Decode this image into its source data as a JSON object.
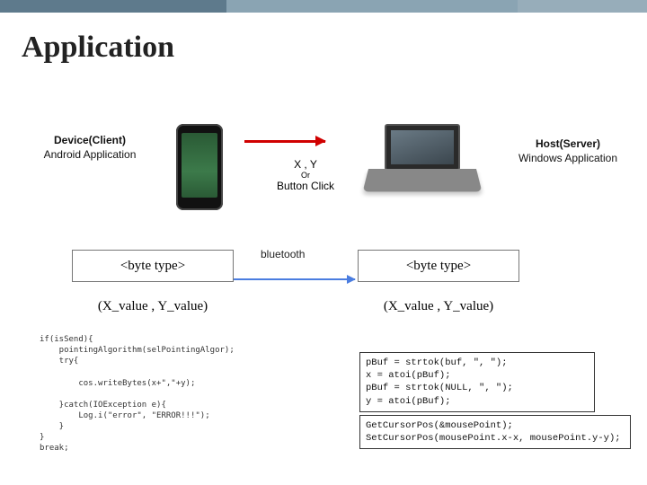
{
  "title": "Application",
  "client": {
    "heading": "Device(Client)",
    "sub": "Android Application"
  },
  "host": {
    "heading": "Host(Server)",
    "sub": "Windows Application"
  },
  "transfer": {
    "xy": "X , Y",
    "or": "Or",
    "btn": "Button Click"
  },
  "bt_label": "bluetooth",
  "byte_type": "<byte type>",
  "xy_value": "(X_value , Y_value)",
  "code_left": "if(isSend){\n    pointingAlgorithm(selPointingAlgor);\n    try{\n\n        cos.writeBytes(x+\",\"+y);\n\n    }catch(IOException e){\n        Log.i(\"error\", \"ERROR!!!\");\n    }\n}\nbreak;",
  "code_top": "pBuf = strtok(buf, \", \");\nx = atoi(pBuf);\npBuf = strtok(NULL, \", \");\ny = atoi(pBuf);",
  "code_bot": "GetCursorPos(&mousePoint);\nSetCursorPos(mousePoint.x-x, mousePoint.y-y);"
}
